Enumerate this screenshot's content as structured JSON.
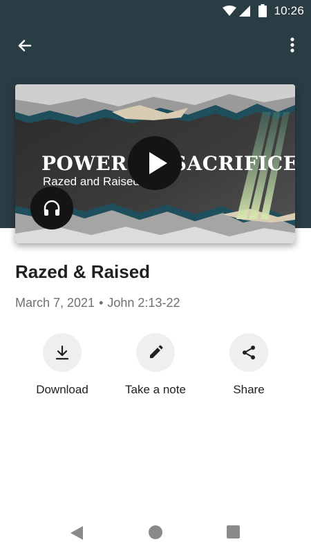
{
  "status_bar": {
    "time": "10:26",
    "icons": [
      "wifi-icon",
      "signal-icon",
      "battery-icon"
    ]
  },
  "app_bar": {
    "back_icon": "arrow-back-icon",
    "more_icon": "more-vert-icon"
  },
  "media": {
    "banner_title": "POWER OF SACRIFICE",
    "banner_subtitle": "Razed and Raised",
    "play_icon": "play-icon",
    "audio_icon": "headphones-icon"
  },
  "sermon": {
    "title": "Razed & Raised",
    "date": "March 7, 2021",
    "separator": "•",
    "reference": "John 2:13-22"
  },
  "actions": [
    {
      "label": "Download",
      "icon": "download-icon"
    },
    {
      "label": "Take a note",
      "icon": "pencil-icon"
    },
    {
      "label": "Share",
      "icon": "share-icon"
    }
  ],
  "nav_bar": {
    "icons": [
      "nav-back-icon",
      "nav-home-icon",
      "nav-recents-icon"
    ]
  },
  "colors": {
    "header": "#2b3d44",
    "button_circle": "#efefef",
    "meta_text": "#6f6f6f"
  }
}
